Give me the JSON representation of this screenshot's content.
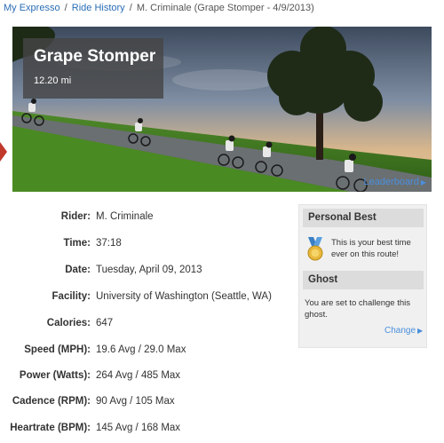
{
  "breadcrumb": {
    "home": "My Expresso",
    "history": "Ride History",
    "current": "M. Criminale (Grape Stomper - 4/9/2013)",
    "separator": "/"
  },
  "hero": {
    "title": "Grape Stomper",
    "distance": "12.20 mi",
    "leaderboard": "Leaderboard"
  },
  "details": [
    {
      "label": "Rider:",
      "value": "M. Criminale"
    },
    {
      "label": "Time:",
      "value": "37:18"
    },
    {
      "label": "Date:",
      "value": "Tuesday, April 09, 2013"
    },
    {
      "label": "Facility:",
      "value": "University of Washington (Seattle, WA)"
    },
    {
      "label": "Calories:",
      "value": "647"
    },
    {
      "label": "Speed (MPH):",
      "value": "19.6 Avg / 29.0 Max"
    },
    {
      "label": "Power (Watts):",
      "value": "264 Avg / 485 Max"
    },
    {
      "label": "Cadence (RPM):",
      "value": "90 Avg / 105 Max"
    },
    {
      "label": "Heartrate (BPM):",
      "value": "145 Avg / 168 Max"
    }
  ],
  "sidebar": {
    "personal_best_title": "Personal Best",
    "personal_best_text": "This is your best time ever on this route!",
    "ghost_title": "Ghost",
    "ghost_text": "You are set to challenge this ghost.",
    "change": "Change"
  },
  "colors": {
    "link": "#2a6db5",
    "accent_link": "#4a8fdc",
    "panel_bg": "#f0f0f0",
    "panel_head": "#dcdcdc"
  }
}
